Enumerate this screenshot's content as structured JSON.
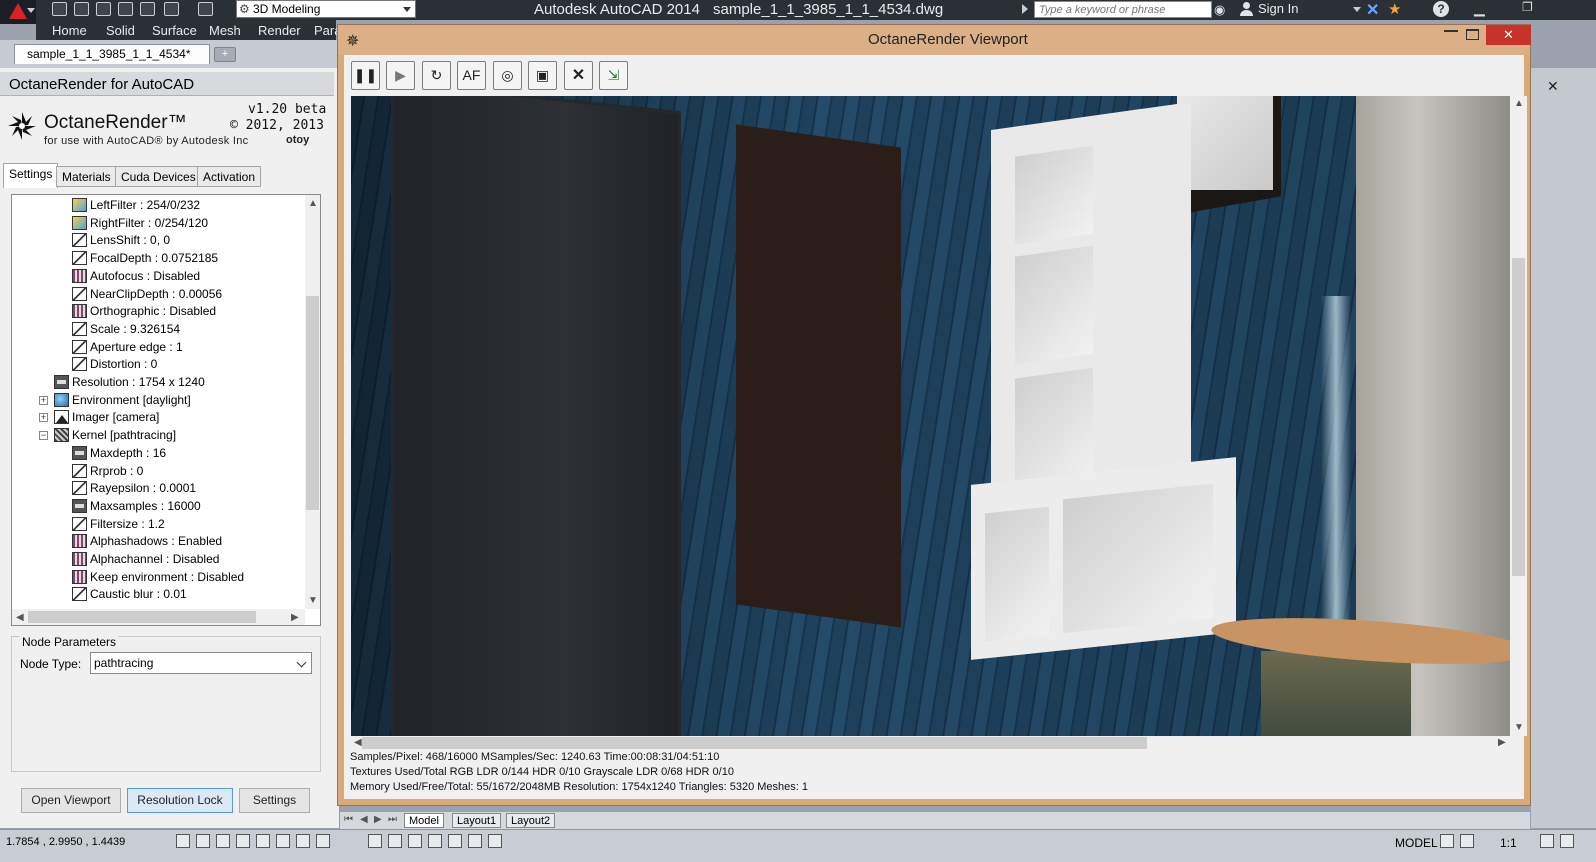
{
  "acad": {
    "workspace": "3D Modeling",
    "app_name": "Autodesk AutoCAD 2014",
    "doc_name": "sample_1_1_3985_1_1_4534.dwg",
    "search_placeholder": "Type a keyword or phrase",
    "sign_in": "Sign In",
    "help": "?",
    "ribbon_tabs": [
      "Home",
      "Solid",
      "Surface",
      "Mesh",
      "Render",
      "Para"
    ],
    "doc_tab": "sample_1_1_3985_1_1_4534*",
    "coords": "1.7854 , 2.9950 , 1.4439",
    "layout_tabs": [
      "Model",
      "Layout1",
      "Layout2"
    ],
    "model_label": "MODEL",
    "scale": "1:1"
  },
  "panel": {
    "title": "OctaneRender for AutoCAD",
    "brand": "OctaneRender™",
    "brand_sub": "for use with AutoCAD® by Autodesk Inc",
    "version": "v1.20 beta",
    "copyright": "© 2012, 2013",
    "otoy": "otoy",
    "tabs": [
      "Settings",
      "Materials",
      "Cuda Devices",
      "Activation"
    ],
    "tree": [
      {
        "label": "LeftFilter : 254/0/232",
        "icon": "grad",
        "level": 2
      },
      {
        "label": "RightFilter : 0/254/120",
        "icon": "grad",
        "level": 2
      },
      {
        "label": "LensShift : 0, 0",
        "icon": "curve",
        "level": 2
      },
      {
        "label": "FocalDepth : 0.0752185",
        "icon": "curve",
        "level": 2
      },
      {
        "label": "Autofocus : Disabled",
        "icon": "pink",
        "level": 2
      },
      {
        "label": "NearClipDepth : 0.00056",
        "icon": "curve",
        "level": 2
      },
      {
        "label": "Orthographic : Disabled",
        "icon": "pink",
        "level": 2
      },
      {
        "label": "Scale : 9.326154",
        "icon": "curve",
        "level": 2
      },
      {
        "label": "Aperture edge : 1",
        "icon": "curve",
        "level": 2
      },
      {
        "label": "Distortion : 0",
        "icon": "curve",
        "level": 2
      },
      {
        "label": "Resolution : 1754 x 1240",
        "icon": "dark",
        "level": 1
      },
      {
        "label": "Environment  [daylight]",
        "icon": "env",
        "level": 1,
        "expander": "+"
      },
      {
        "label": "Imager  [camera]",
        "icon": "img",
        "level": 1,
        "expander": "+"
      },
      {
        "label": "Kernel  [pathtracing]",
        "icon": "kern",
        "level": 1,
        "expander": "-"
      },
      {
        "label": "Maxdepth : 16",
        "icon": "dark",
        "level": 2
      },
      {
        "label": "Rrprob : 0",
        "icon": "curve",
        "level": 2
      },
      {
        "label": "Rayepsilon : 0.0001",
        "icon": "curve",
        "level": 2
      },
      {
        "label": "Maxsamples : 16000",
        "icon": "dark",
        "level": 2
      },
      {
        "label": "Filtersize : 1.2",
        "icon": "curve",
        "level": 2
      },
      {
        "label": "Alphashadows : Enabled",
        "icon": "pink",
        "level": 2
      },
      {
        "label": "Alphachannel : Disabled",
        "icon": "pink",
        "level": 2
      },
      {
        "label": "Keep environment : Disabled",
        "icon": "pink",
        "level": 2
      },
      {
        "label": "Caustic blur : 0.01",
        "icon": "curve",
        "level": 2
      }
    ],
    "node_params": {
      "group_label": "Node Parameters",
      "node_type_label": "Node Type:",
      "node_type_value": "pathtracing"
    },
    "buttons": {
      "open_viewport": "Open Viewport",
      "resolution_lock": "Resolution Lock",
      "settings": "Settings"
    }
  },
  "viewport": {
    "title": "OctaneRender Viewport",
    "close": "✕",
    "stats": [
      "Samples/Pixel: 468/16000  MSamples/Sec: 1240.63  Time:00:08:31/04:51:10",
      "Textures Used/Total RGB LDR 0/144  HDR 0/10  Grayscale LDR 0/68  HDR 0/10",
      "Memory Used/Free/Total: 55/1672/2048MB  Resolution: 1754x1240  Triangles: 5320  Meshes:  1"
    ]
  },
  "colors": {
    "acad_dark": "#2b2f36",
    "viewport_frame": "#d9a978",
    "close_red": "#c7332b",
    "wall_blue": "#1e415c"
  }
}
